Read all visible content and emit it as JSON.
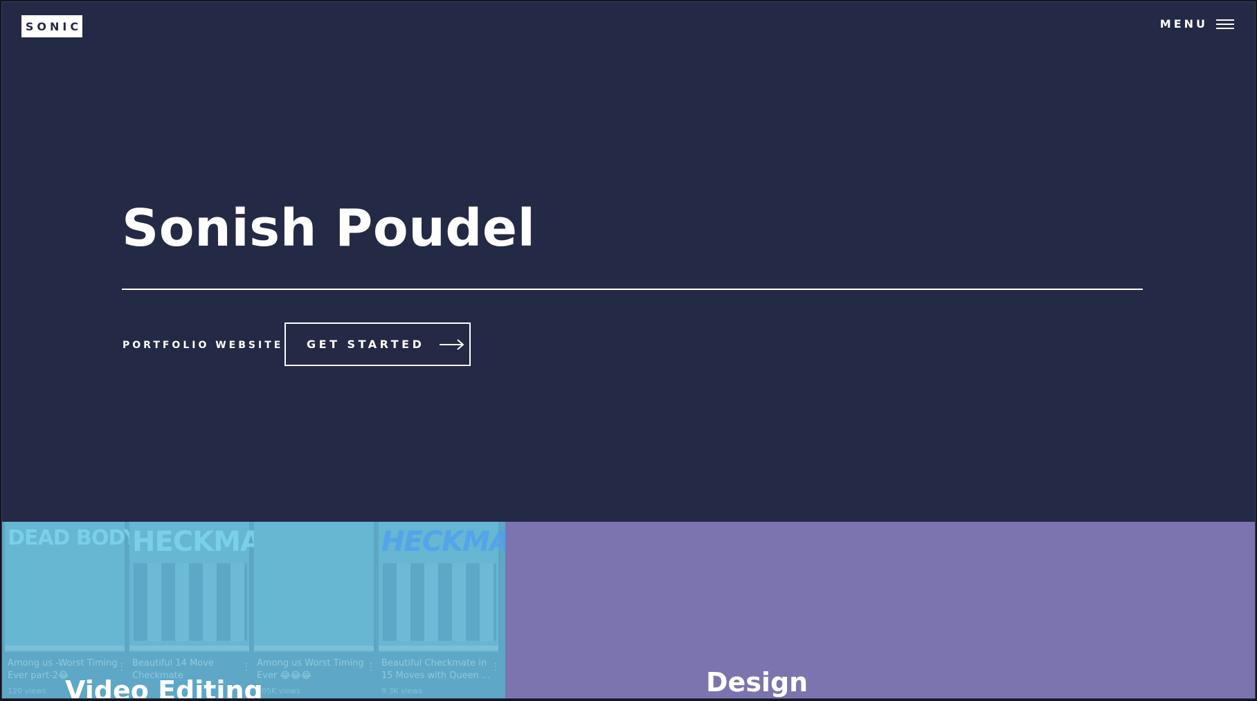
{
  "header": {
    "logo_text": "SONIC",
    "menu_label": "MENU"
  },
  "hero": {
    "title": "Sonish Poudel",
    "tagline": "PORTFOLIO WEBSITE",
    "cta_label": "GET STARTED"
  },
  "panels": {
    "video": {
      "label": "Video Editing",
      "thumbs": [
        {
          "art": "DEAD BODY",
          "caption": "Among us -Worst Timing Ever part-2😂",
          "views": "120 views"
        },
        {
          "art": "HECKMA",
          "caption": "Beautiful 14 Move Checkmate",
          "views": ""
        },
        {
          "art": "",
          "caption": "Among us Worst Timing Ever 😂😂😂",
          "views": "105K views"
        },
        {
          "art": "HECKMA",
          "caption": "Beautiful Checkmate in 15 Moves with Queen ...",
          "views": "9.3K views"
        }
      ]
    },
    "design": {
      "label": "Design"
    }
  },
  "colors": {
    "background": "#242945",
    "video_panel": "#5ea7c6",
    "design_panel": "#7c74af"
  }
}
